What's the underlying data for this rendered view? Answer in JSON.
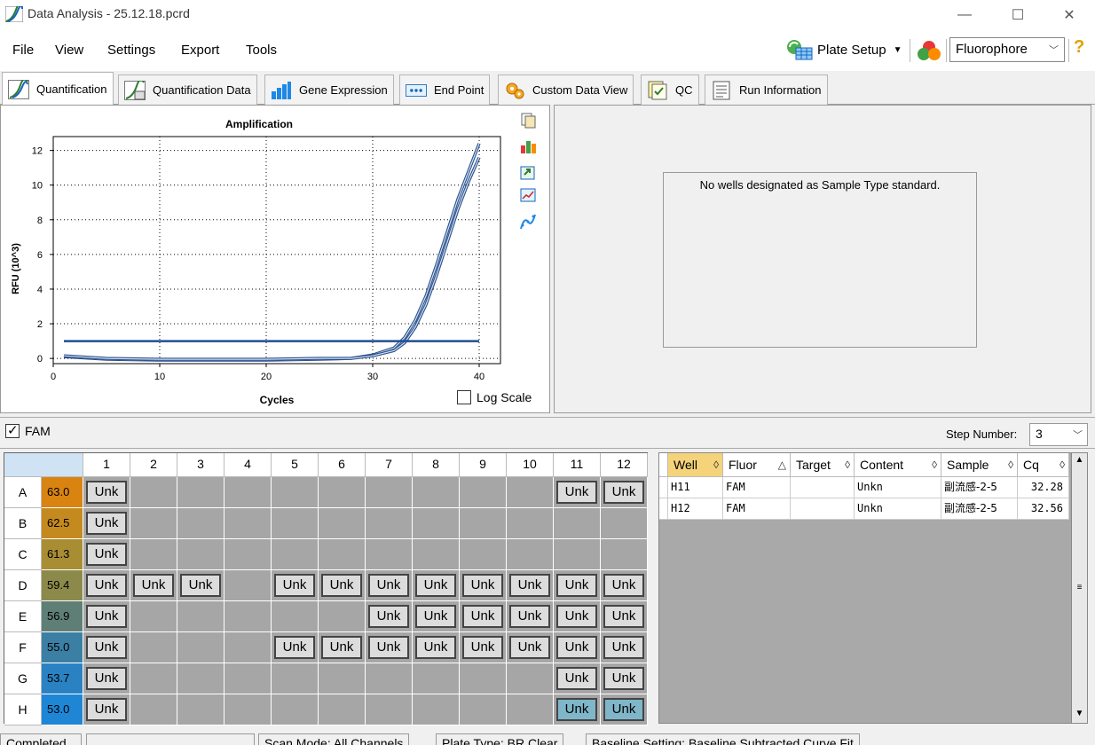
{
  "window": {
    "title": "Data Analysis - 25.12.18.pcrd"
  },
  "menu": [
    "File",
    "View",
    "Settings",
    "Export",
    "Tools"
  ],
  "toolbar": {
    "plate_setup_label": "Plate Setup",
    "fluorophore_value": "Fluorophore"
  },
  "tabs": [
    "Quantification",
    "Quantification Data",
    "Gene Expression",
    "End Point",
    "Custom Data View",
    "QC",
    "Run Information"
  ],
  "chart_data": {
    "type": "line",
    "title": "Amplification",
    "xlabel": "Cycles",
    "ylabel": "RFU (10^3)",
    "xlim": [
      0,
      42
    ],
    "ylim": [
      -0.3,
      12.8
    ],
    "xticks": [
      "0",
      "10",
      "20",
      "30",
      "40"
    ],
    "yticks": [
      "0",
      "2",
      "4",
      "6",
      "8",
      "10",
      "12"
    ],
    "grid": true,
    "series": [
      {
        "x": [
          1,
          5,
          10,
          15,
          20,
          25,
          28,
          30,
          32,
          33,
          34,
          35,
          36,
          37,
          38,
          39,
          40
        ],
        "values": [
          0.1,
          -0.05,
          -0.1,
          -0.1,
          -0.1,
          -0.05,
          0.0,
          0.2,
          0.6,
          1.2,
          2.2,
          3.6,
          5.4,
          7.3,
          9.2,
          10.8,
          12.4
        ]
      },
      {
        "x": [
          1,
          5,
          10,
          15,
          20,
          25,
          28,
          30,
          32,
          33,
          34,
          35,
          36,
          37,
          38,
          39,
          40
        ],
        "values": [
          0.15,
          0.0,
          -0.05,
          -0.05,
          -0.05,
          0.0,
          0.0,
          0.15,
          0.45,
          0.9,
          1.8,
          3.1,
          4.8,
          6.7,
          8.6,
          10.2,
          11.6
        ]
      },
      {
        "x": [
          1,
          40
        ],
        "values": [
          1.0,
          1.0
        ]
      }
    ]
  },
  "log_scale_label": "Log Scale",
  "std_message": "No wells designated as Sample Type standard.",
  "fam_label": "FAM",
  "step": {
    "label": "Step Number:",
    "value": "3"
  },
  "plate": {
    "columns": [
      "1",
      "2",
      "3",
      "4",
      "5",
      "6",
      "7",
      "8",
      "9",
      "10",
      "11",
      "12"
    ],
    "rows": [
      {
        "label": "A",
        "temp": "63.0",
        "temp_color": "#d98411",
        "wells": [
          "Unk",
          "",
          "",
          "",
          "",
          "",
          "",
          "",
          "",
          "",
          "Unk",
          "Unk"
        ]
      },
      {
        "label": "B",
        "temp": "62.5",
        "temp_color": "#c58a1f",
        "wells": [
          "Unk",
          "",
          "",
          "",
          "",
          "",
          "",
          "",
          "",
          "",
          "",
          ""
        ]
      },
      {
        "label": "C",
        "temp": "61.3",
        "temp_color": "#a98d33",
        "wells": [
          "Unk",
          "",
          "",
          "",
          "",
          "",
          "",
          "",
          "",
          "",
          "",
          ""
        ]
      },
      {
        "label": "D",
        "temp": "59.4",
        "temp_color": "#8c8a4a",
        "wells": [
          "Unk",
          "Unk",
          "Unk",
          "",
          "Unk",
          "Unk",
          "Unk",
          "Unk",
          "Unk",
          "Unk",
          "Unk",
          "Unk"
        ]
      },
      {
        "label": "E",
        "temp": "56.9",
        "temp_color": "#5f7f76",
        "wells": [
          "Unk",
          "",
          "",
          "",
          "",
          "",
          "Unk",
          "Unk",
          "Unk",
          "Unk",
          "Unk",
          "Unk"
        ]
      },
      {
        "label": "F",
        "temp": "55.0",
        "temp_color": "#3b7fa4",
        "wells": [
          "Unk",
          "",
          "",
          "",
          "Unk",
          "Unk",
          "Unk",
          "Unk",
          "Unk",
          "Unk",
          "Unk",
          "Unk"
        ]
      },
      {
        "label": "G",
        "temp": "53.7",
        "temp_color": "#2a82c2",
        "wells": [
          "Unk",
          "",
          "",
          "",
          "",
          "",
          "",
          "",
          "",
          "",
          "Unk",
          "Unk"
        ]
      },
      {
        "label": "H",
        "temp": "53.0",
        "temp_color": "#1f86d6",
        "wells": [
          "Unk",
          "",
          "",
          "",
          "",
          "",
          "",
          "",
          "",
          "",
          "Unk",
          "Unk"
        ]
      }
    ],
    "selected": [
      "H11",
      "H12"
    ]
  },
  "results": {
    "headers": [
      "Well",
      "Fluor",
      "Target",
      "Content",
      "Sample",
      "Cq"
    ],
    "sort_marks": [
      "◊",
      "△",
      "◊",
      "◊",
      "◊",
      "◊"
    ],
    "rows": [
      [
        "H11",
        "FAM",
        "",
        "Unkn",
        "副流感-2-5",
        "32.28"
      ],
      [
        "H12",
        "FAM",
        "",
        "Unkn",
        "副流感-2-5",
        "32.56"
      ]
    ]
  },
  "status": [
    "Completed",
    "",
    "Scan Mode: All Channels",
    "Plate Type: BR Clear",
    "Baseline Setting: Baseline Subtracted Curve Fit"
  ]
}
